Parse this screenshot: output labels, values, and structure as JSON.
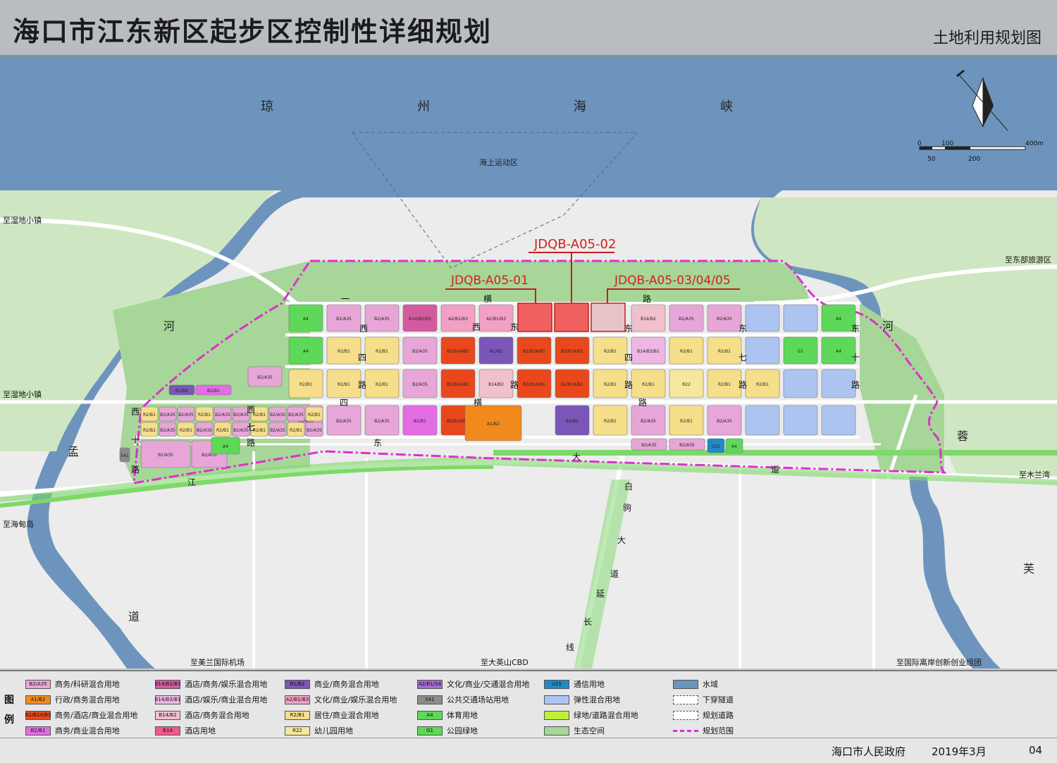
{
  "header": {
    "title": "海口市江东新区起步区控制性详细规划",
    "subtitle": "土地利用规划图"
  },
  "map_labels": {
    "strait": [
      "琼",
      "州",
      "海",
      "峡"
    ],
    "sea_zone": "海上运动区",
    "river_left": "河",
    "river_right": "河",
    "meng": "孟",
    "rong": "蓉",
    "dao_left": "道",
    "fu": "芙",
    "to_shidi_top": "至湿地小镇",
    "to_shidi_mid": "至湿地小镇",
    "to_haidian": "至海甸岛",
    "to_dongbu": "至东部旅游区",
    "to_mulanwan": "至木兰湾",
    "to_meilan": "至美兰国际机场",
    "to_dayingshan": "至大英山CBD",
    "to_guoji": "至国际离岸创新创业组团",
    "road_labels": {
      "yi_heng": "一",
      "heng": "横",
      "lu": "路",
      "xi": "西",
      "dong": "东",
      "si": "四",
      "qi": "七",
      "shi": "十",
      "jiang": "江",
      "da": "大",
      "dao": "道",
      "bai": "白",
      "ju": "驹",
      "yan": "延",
      "chang": "长",
      "xian": "线"
    },
    "parcel_tags": [
      "JDQB-A05-01",
      "JDQB-A05-02",
      "JDQB-A05-03/04/05"
    ],
    "parcel_codes": {
      "a4": "A4",
      "g1": "G1",
      "b2a35": "B2/A35",
      "b2b1": "B2/B1",
      "r2b1": "R2/B1",
      "b14b2b3": "B14/B2/B3",
      "a2b1b3": "A2/B1/B3",
      "b2b14b1": "B2/B14/B1",
      "b14b2": "B14/B2",
      "b1b2": "B1/B2",
      "a1b2": "A1/B2",
      "a2b1s4": "A2/B1/S4",
      "b14b3b1": "B14/B3/B1",
      "r22": "R22",
      "u15": "U15",
      "s41": "S41",
      "b14": "B14"
    }
  },
  "scale_bar": {
    "ticks_top": [
      "0",
      "100",
      "400m"
    ],
    "ticks_bottom": [
      "50",
      "200"
    ]
  },
  "legend": {
    "heading": [
      "图",
      "例"
    ],
    "items": [
      {
        "code": "B2/A35",
        "label": "商务/科研混合用地",
        "color": "#e8a6d8"
      },
      {
        "code": "A1/B2",
        "label": "行政/商务混合用地",
        "color": "#f08a1c"
      },
      {
        "code": "B2/B14/B1",
        "label": "商务/酒店/商业混合用地",
        "color": "#e8481c"
      },
      {
        "code": "B2/B1",
        "label": "商务/商业混合用地",
        "color": "#e46ce4"
      },
      {
        "code": "B14/B2/B3",
        "label": "酒店/商务/娱乐混合用地",
        "color": "#d45aa0"
      },
      {
        "code": "B14/B3/B1",
        "label": "酒店/娱乐/商业混合用地",
        "color": "#eeb6e2"
      },
      {
        "code": "B14/B2",
        "label": "酒店/商务混合用地",
        "color": "#f0c0cc"
      },
      {
        "code": "B14",
        "label": "酒店用地",
        "color": "#ee5a8a"
      },
      {
        "code": "B1/B2",
        "label": "商业/商务混合用地",
        "color": "#7a56b8"
      },
      {
        "code": "A2/B1/B3",
        "label": "文化/商业/娱乐混合用地",
        "color": "#f2a0c4"
      },
      {
        "code": "R2/B1",
        "label": "居住/商业混合用地",
        "color": "#f6de8a"
      },
      {
        "code": "R22",
        "label": "幼儿园用地",
        "color": "#f6e69e"
      },
      {
        "code": "A2/B1/S4",
        "label": "文化/商业/交通混合用地",
        "color": "#a56ad2"
      },
      {
        "code": "S41",
        "label": "公共交通场站用地",
        "color": "#8c8c8c"
      },
      {
        "code": "A4",
        "label": "体育用地",
        "color": "#5ed858"
      },
      {
        "code": "G1",
        "label": "公园绿地",
        "color": "#5ed858"
      },
      {
        "code": "U15",
        "label": "通信用地",
        "color": "#1f8ac6"
      },
      {
        "code": "",
        "label": "弹性混合用地",
        "color": "#adc4f0"
      },
      {
        "code": "",
        "label": "绿地/道路混合用地",
        "color": "#bff03a"
      },
      {
        "code": "",
        "label": "生态空间",
        "color": "#a6d698"
      },
      {
        "code": "",
        "label": "水域",
        "color": "#6d94bd"
      },
      {
        "code": "",
        "label": "下穿隧道",
        "color": "#ffffff"
      },
      {
        "code": "",
        "label": "规划道路",
        "color": "#ffffff"
      },
      {
        "code": "",
        "label": "规划范围",
        "color": "#e02ed0"
      }
    ]
  },
  "footer": {
    "authority": "海口市人民政府",
    "date": "2019年3月",
    "page": "04"
  },
  "colors": {
    "water": "#6d94bd",
    "eco": "#a6d698",
    "eco_light": "#cfe6c2",
    "base": "#eeeeee",
    "boundary": "#e02ed0",
    "tag": "#d42020",
    "plot_red": "#f06060",
    "plot_pale": "#e8c4c8"
  }
}
